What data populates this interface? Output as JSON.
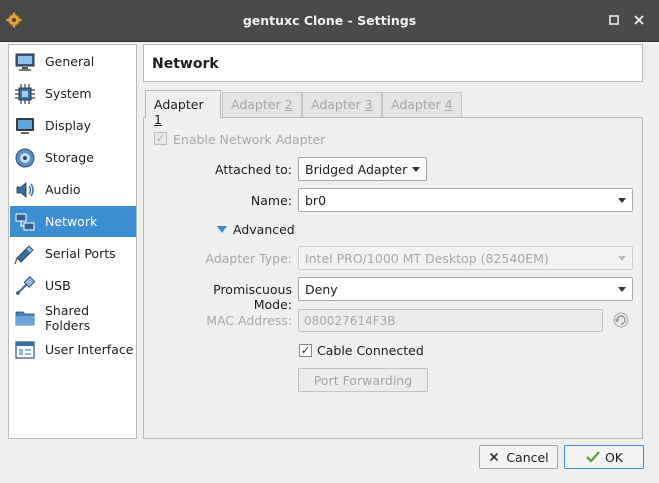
{
  "window": {
    "title": "gentuxc Clone - Settings"
  },
  "sidebar": {
    "items": [
      {
        "label": "General",
        "icon": "monitor-icon"
      },
      {
        "label": "System",
        "icon": "chip-icon"
      },
      {
        "label": "Display",
        "icon": "display-icon"
      },
      {
        "label": "Storage",
        "icon": "disk-icon"
      },
      {
        "label": "Audio",
        "icon": "speaker-icon"
      },
      {
        "label": "Network",
        "icon": "network-icon",
        "active": true
      },
      {
        "label": "Serial Ports",
        "icon": "serial-icon"
      },
      {
        "label": "USB",
        "icon": "usb-icon"
      },
      {
        "label": "Shared Folders",
        "icon": "folder-icon"
      },
      {
        "label": "User Interface",
        "icon": "ui-icon"
      }
    ]
  },
  "page": {
    "title": "Network"
  },
  "tabs": [
    {
      "prefix": "Adapter ",
      "num": "1",
      "active": true
    },
    {
      "prefix": "Adapter ",
      "num": "2"
    },
    {
      "prefix": "Adapter ",
      "num": "3"
    },
    {
      "prefix": "Adapter ",
      "num": "4"
    }
  ],
  "adapter": {
    "enable_label": "Enable Network Adapter",
    "attached_label": "Attached to:",
    "attached_value": "Bridged Adapter",
    "name_label": "Name:",
    "name_value": "br0",
    "advanced_label": "Advanced",
    "type_label": "Adapter Type:",
    "type_value": "Intel PRO/1000 MT Desktop (82540EM)",
    "promisc_label": "Promiscuous Mode:",
    "promisc_value": "Deny",
    "mac_label": "MAC Address:",
    "mac_value": "080027614F3B",
    "cable_label": "Cable Connected",
    "port_forwarding_label": "Port Forwarding"
  },
  "buttons": {
    "cancel": "Cancel",
    "ok": "OK"
  },
  "colors": {
    "accent": "#3b8ed1",
    "titlebar": "#4a4a4a"
  }
}
